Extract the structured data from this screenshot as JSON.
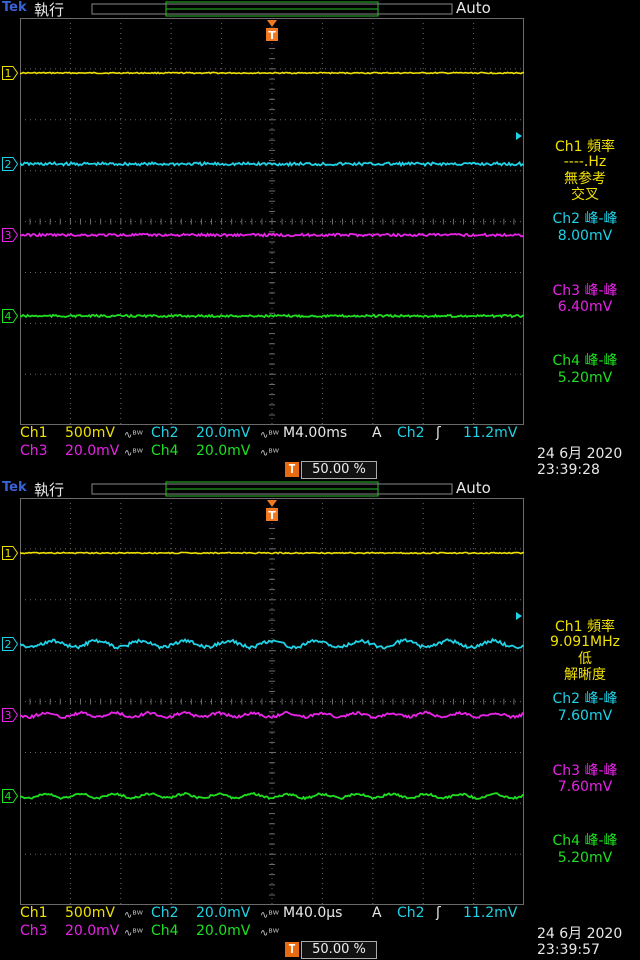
{
  "colors": {
    "ch1": "#f0e000",
    "ch2": "#1fd2e6",
    "ch3": "#e824e8",
    "ch4": "#1ee020",
    "grid": "#6a6a6a",
    "trigger": "#f07820",
    "bar_text": "#f0e000"
  },
  "screens": [
    {
      "header": {
        "brand": "Tek",
        "run_state": "執行",
        "trigger_mode": "Auto"
      },
      "channel_markers": [
        "1",
        "2",
        "3",
        "4"
      ],
      "readouts": {
        "ch1_freq_label": "Ch1 頻率",
        "ch1_freq_value": "----.Hz",
        "ch1_note_a": "無参考",
        "ch1_note_b": "交叉",
        "ch2_label": "Ch2 峰-峰",
        "ch2_value": "8.00mV",
        "ch3_label": "Ch3 峰-峰",
        "ch3_value": "6.40mV",
        "ch4_label": "Ch4 峰-峰",
        "ch4_value": "5.20mV"
      },
      "status": {
        "ch1_label": "Ch1",
        "ch1_scale": "500mV",
        "ch2_label": "Ch2",
        "ch2_scale": "20.0mV",
        "timebase": "M4.00ms",
        "trig_source_label": "A",
        "trig_channel": "Ch2",
        "trig_slope": "ʃ",
        "trig_level": "11.2mV",
        "ch3_label": "Ch3",
        "ch3_scale": "20.0mV",
        "ch4_label": "Ch4",
        "ch4_scale": "20.0mV",
        "trigger_position": "50.00 %",
        "date": "24 6月  2020",
        "time": "23:39:28",
        "bw_symbol": "∿ᴮᵂ",
        "trig_badge": "T"
      },
      "trace_ripple": {
        "ch2": 0.0,
        "ch3": 0.0,
        "ch4": 0.0
      }
    },
    {
      "header": {
        "brand": "Tek",
        "run_state": "執行",
        "trigger_mode": "Auto"
      },
      "channel_markers": [
        "1",
        "2",
        "3",
        "4"
      ],
      "readouts": {
        "ch1_freq_label": "Ch1 頻率",
        "ch1_freq_value": "9.091MHz",
        "ch1_note_a": "低",
        "ch1_note_b": "解晰度",
        "ch2_label": "Ch2 峰-峰",
        "ch2_value": "7.60mV",
        "ch3_label": "Ch3 峰-峰",
        "ch3_value": "7.60mV",
        "ch4_label": "Ch4 峰-峰",
        "ch4_value": "5.20mV"
      },
      "status": {
        "ch1_label": "Ch1",
        "ch1_scale": "500mV",
        "ch2_label": "Ch2",
        "ch2_scale": "20.0mV",
        "timebase": "M40.0µs",
        "trig_source_label": "A",
        "trig_channel": "Ch2",
        "trig_slope": "ʃ",
        "trig_level": "11.2mV",
        "ch3_label": "Ch3",
        "ch3_scale": "20.0mV",
        "ch4_label": "Ch4",
        "ch4_scale": "20.0mV",
        "trigger_position": "50.00 %",
        "date": "24 6月  2020",
        "time": "23:39:57",
        "bw_symbol": "∿ᴮᵂ",
        "trig_badge": "T"
      },
      "trace_ripple": {
        "ch2": 1.0,
        "ch3": 1.0,
        "ch4": 1.0
      }
    }
  ]
}
